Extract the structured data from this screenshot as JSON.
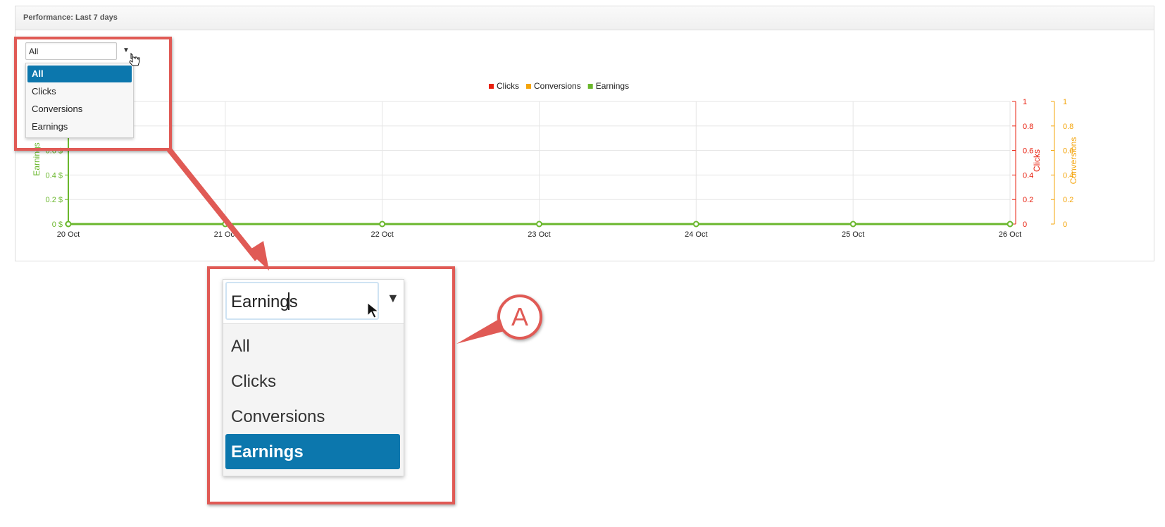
{
  "panel": {
    "title": "Performance: Last 7 days"
  },
  "dropdown": {
    "value": "All",
    "options": [
      "All",
      "Clicks",
      "Conversions",
      "Earnings"
    ],
    "selected_index": 0
  },
  "zoom_dropdown": {
    "value": "Earnings",
    "options": [
      "All",
      "Clicks",
      "Conversions",
      "Earnings"
    ],
    "selected_index": 3
  },
  "callout": {
    "label": "A"
  },
  "colors": {
    "clicks": "#e8200f",
    "conversions": "#f4a40a",
    "earnings": "#6ab72c",
    "callout": "#e05a55",
    "selected": "#0c77ad"
  },
  "icons": {
    "dropdown_caret": "triangle-down-icon",
    "cursor": "hand-cursor-icon"
  },
  "chart_data": {
    "type": "line",
    "title": "",
    "x": [
      "20 Oct",
      "21 Oct",
      "22 Oct",
      "23 Oct",
      "24 Oct",
      "25 Oct",
      "26 Oct"
    ],
    "series": [
      {
        "name": "Clicks",
        "values": [
          0,
          0,
          0,
          0,
          0,
          0,
          0
        ],
        "axis": "right-1"
      },
      {
        "name": "Conversions",
        "values": [
          0,
          0,
          0,
          0,
          0,
          0,
          0
        ],
        "axis": "right-2"
      },
      {
        "name": "Earnings",
        "values": [
          0,
          0,
          0,
          0,
          0,
          0,
          0
        ],
        "axis": "left"
      }
    ],
    "axes": {
      "left": {
        "label": "Earnings",
        "ticks": [
          "0 $",
          "0.2 $",
          "0.4 $",
          "0.6 $"
        ],
        "range": [
          0,
          1
        ]
      },
      "right_1": {
        "label": "Clicks",
        "ticks": [
          "0",
          "0.2",
          "0.4",
          "0.6",
          "0.8",
          "1"
        ],
        "range": [
          0,
          1
        ]
      },
      "right_2": {
        "label": "Conversions",
        "ticks": [
          "0",
          "0.2",
          "0.4",
          "0.6",
          "0.8",
          "1"
        ],
        "range": [
          0,
          1
        ]
      }
    },
    "legend": {
      "position": "top-center",
      "entries": [
        "Clicks",
        "Conversions",
        "Earnings"
      ]
    },
    "grid": true
  }
}
